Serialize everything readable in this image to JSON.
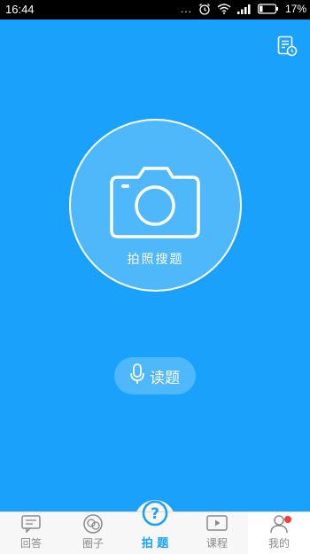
{
  "status_bar": {
    "time": "16:44",
    "dots": "...",
    "battery_percent": "17%",
    "icons": [
      "alarm-icon",
      "wifi-icon",
      "signal-icon",
      "battery-icon"
    ]
  },
  "header": {
    "history_icon": "history-list-icon"
  },
  "camera": {
    "label": "拍照搜题",
    "icon": "camera-icon"
  },
  "voice": {
    "label": "读题",
    "icon": "microphone-icon"
  },
  "tabs": [
    {
      "label": "回答",
      "icon": "chat-icon",
      "active": false
    },
    {
      "label": "圈子",
      "icon": "circle-community-icon",
      "active": false
    },
    {
      "label": "拍 题",
      "icon": "question-icon",
      "active": true
    },
    {
      "label": "课程",
      "icon": "video-play-icon",
      "active": false
    },
    {
      "label": "我的",
      "icon": "user-icon",
      "active": false,
      "badge": true
    }
  ],
  "colors": {
    "primary": "#1aa1fb",
    "circle_fill": "#4eb8fb",
    "tab_inactive": "#8a8a8a",
    "badge": "#f43d3d"
  }
}
